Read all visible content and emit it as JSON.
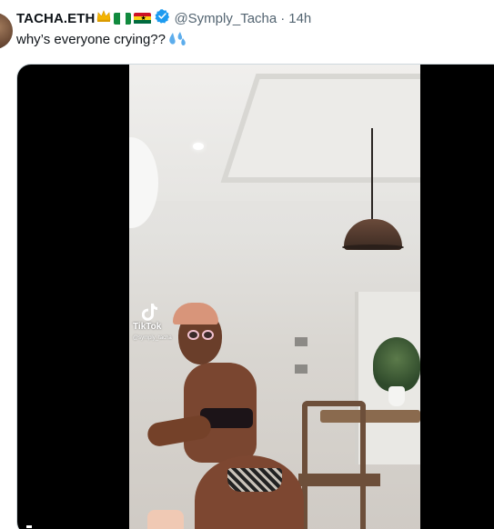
{
  "tweet": {
    "display_name": "TACHA.ETH",
    "badges": [
      "crown-emoji",
      "nigeria-flag",
      "ghana-flag",
      "verified-badge"
    ],
    "handle": "@Symply_Tacha",
    "separator": "·",
    "time": "14h",
    "text": "why’s everyone crying??",
    "text_emoji": "sweat-droplets-emoji"
  },
  "media": {
    "type": "video",
    "watermark": {
      "app": "TikTok",
      "handle": "@symply_tacha"
    }
  },
  "colors": {
    "text_primary": "#0f1419",
    "text_secondary": "#536471",
    "verified_blue": "#1d9bf0",
    "media_background": "#000000"
  }
}
